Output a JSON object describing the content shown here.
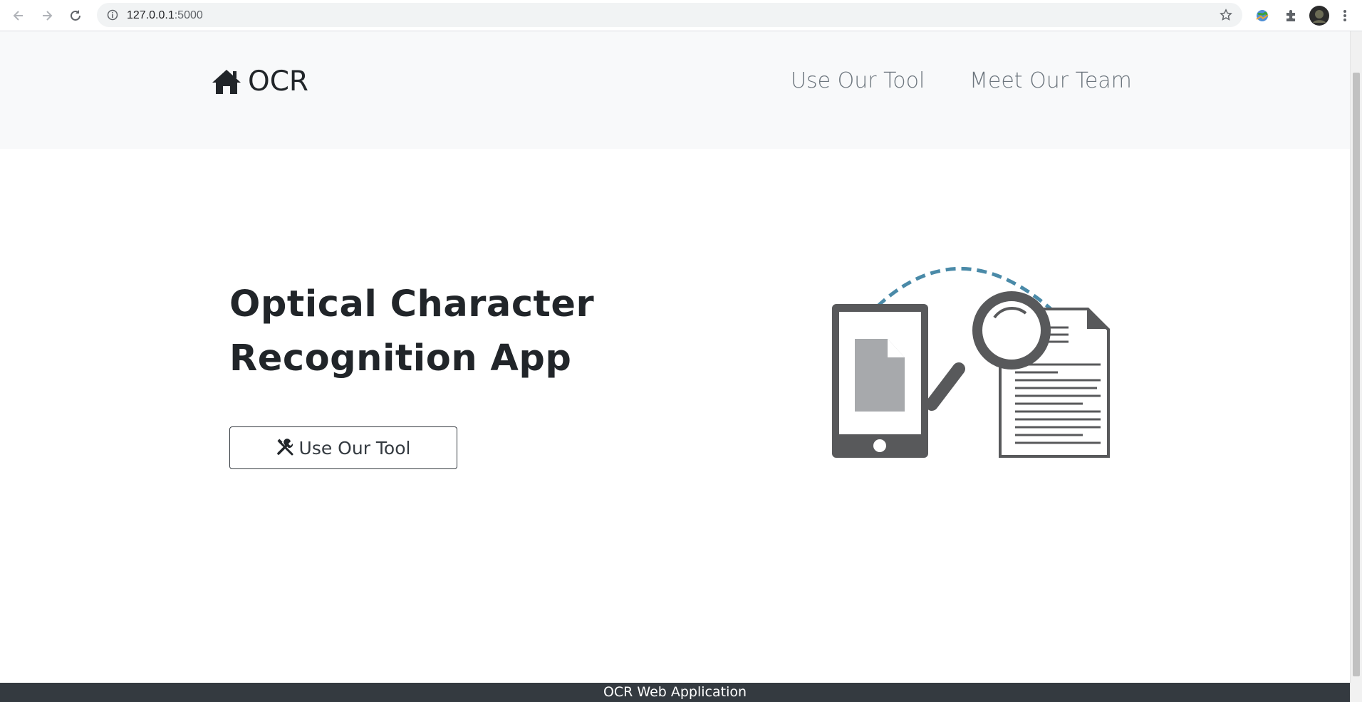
{
  "browser": {
    "url_host": "127.0.0.1",
    "url_port": ":5000",
    "icons": [
      "back-arrow-icon",
      "forward-arrow-icon",
      "reload-icon",
      "info-icon",
      "star-icon",
      "extension-globe-icon",
      "puzzle-icon",
      "avatar",
      "kebab-menu-icon"
    ]
  },
  "navbar": {
    "brand": "OCR",
    "brand_icon": "home-icon",
    "links": [
      "Use Our Tool",
      "Meet Our Team"
    ]
  },
  "hero": {
    "title_line1": "Optical Character",
    "title_line2": "Recognition App",
    "button_label": "Use Our Tool",
    "button_icon": "tools-icon",
    "illustration": "ocr-phone-document-magnifier-illustration"
  },
  "footer": {
    "text": "OCR Web Application"
  },
  "colors": {
    "navbar_bg": "#f8f9fa",
    "footer_bg": "#343a40",
    "nav_link": "#6c757d",
    "text_dark": "#212529",
    "illustration_gray": "#58595b",
    "illustration_dash": "#4a8aa8"
  }
}
